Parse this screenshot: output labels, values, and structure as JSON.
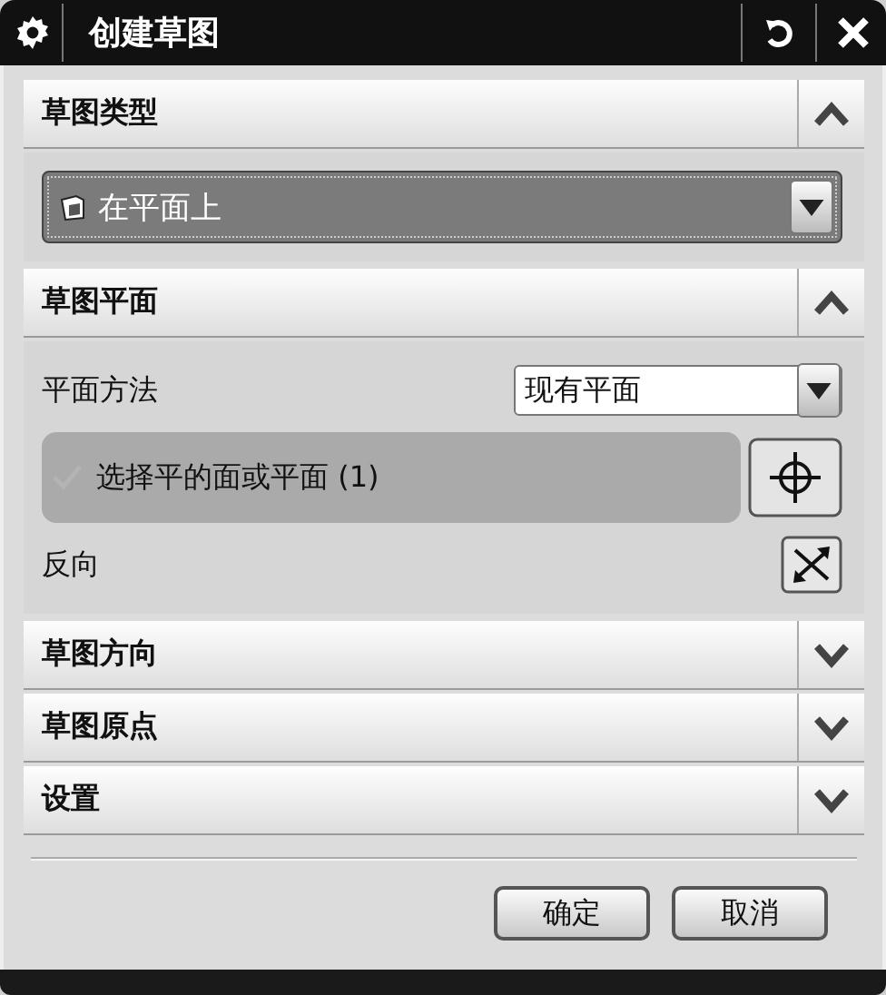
{
  "window": {
    "title": "创建草图"
  },
  "sections": [
    {
      "title": "草图类型",
      "expanded": true,
      "kind": "type",
      "dropdown": {
        "value": "在平面上"
      }
    },
    {
      "title": "草图平面",
      "expanded": true,
      "kind": "plane",
      "method": {
        "label": "平面方法",
        "value": "现有平面"
      },
      "selection": {
        "label": "选择平的面或平面 (1)",
        "checked": true
      },
      "reverse": {
        "label": "反向"
      }
    },
    {
      "title": "草图方向",
      "expanded": false
    },
    {
      "title": "草图原点",
      "expanded": false
    },
    {
      "title": "设置",
      "expanded": false
    }
  ],
  "buttons": [
    "确定",
    "取消"
  ]
}
